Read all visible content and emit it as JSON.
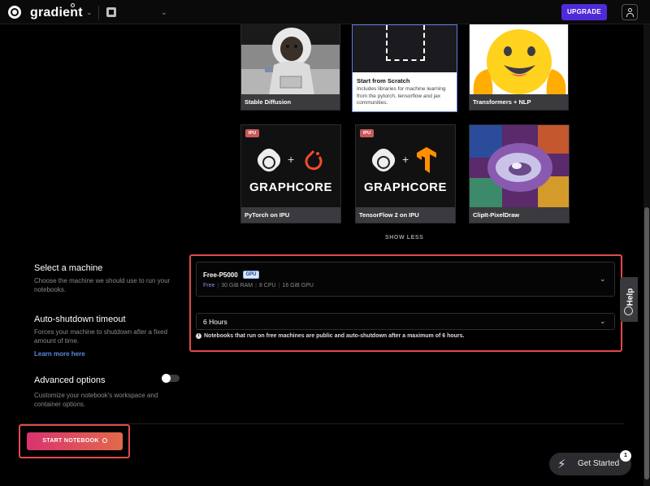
{
  "header": {
    "logo_text": "gradient",
    "upgrade_label": "UPGRADE"
  },
  "templates": [
    {
      "label": "Stable Diffusion"
    },
    {
      "title": "Start from Scratch",
      "description": "Includes libraries for machine learning from the pytorch, tensorflow and jax communities."
    },
    {
      "label": "Transformers + NLP"
    },
    {
      "label": "PyTorch on IPU",
      "badge": "IPU",
      "brand": "GRAPHCORE"
    },
    {
      "label": "TensorFlow 2 on IPU",
      "badge": "IPU",
      "brand": "GRAPHCORE"
    },
    {
      "label": "ClipIt-PixelDraw"
    }
  ],
  "show_less_label": "SHOW LESS",
  "machine": {
    "title": "Select a machine",
    "description": "Choose the machine we should use to run your notebooks.",
    "name": "Free-P5000",
    "badge": "GPU",
    "specs": [
      "Free",
      "30 GiB RAM",
      "8 CPU",
      "16 GiB GPU"
    ]
  },
  "shutdown": {
    "title": "Auto-shutdown timeout",
    "description": "Forces your machine to shutdown after a fixed amount of time.",
    "learn_more": "Learn more here",
    "value": "6 Hours",
    "notice": "Notebooks that run on free machines are public and auto-shutdown after a maximum of 6 hours."
  },
  "advanced": {
    "title": "Advanced options",
    "description": "Customize your notebook's workspace and container options.",
    "enabled": false
  },
  "start_label": "START NOTEBOOK",
  "help_label": "Help",
  "get_started": {
    "label": "Get Started",
    "badge": "1"
  },
  "colors": {
    "accent": "#4e2bd9",
    "highlight": "#e24a47",
    "start_gradient": [
      "#d8336f",
      "#e2694a"
    ]
  }
}
